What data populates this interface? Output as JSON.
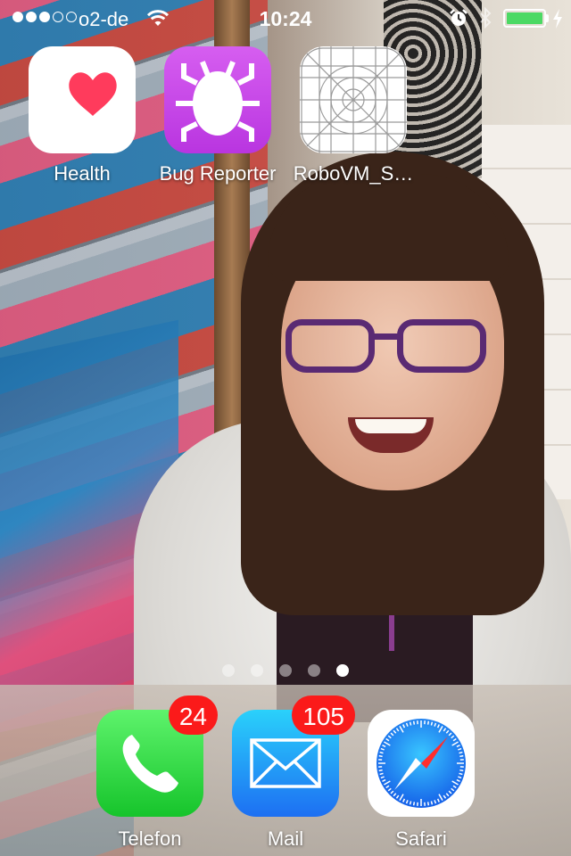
{
  "status_bar": {
    "signal_dots_filled": 3,
    "signal_dots_total": 5,
    "carrier": "o2-de",
    "time": "10:24",
    "battery_level": 1.0,
    "charging": true,
    "icons": [
      "wifi-icon",
      "alarm-icon",
      "bluetooth-icon",
      "battery-icon",
      "charging-bolt-icon"
    ]
  },
  "apps": [
    {
      "label": "Health",
      "icon": "heart-icon"
    },
    {
      "label": "Bug Reporter",
      "icon": "bug-icon"
    },
    {
      "label": "RoboVM_S…",
      "icon": "template-grid-icon"
    }
  ],
  "pager": {
    "count": 5,
    "active_index": 4
  },
  "dock": [
    {
      "label": "Telefon",
      "icon": "phone-icon",
      "badge": "24"
    },
    {
      "label": "Mail",
      "icon": "envelope-icon",
      "badge": "105"
    },
    {
      "label": "Safari",
      "icon": "compass-icon",
      "badge": ""
    }
  ],
  "colors": {
    "badge": "#fb1a1a",
    "battery_fill": "#4cd964",
    "phone_green": "#16c42b",
    "mail_blue": "#1d6ff2",
    "bug_purple": "#b935e0",
    "heart_red": "#ff3b5c"
  }
}
